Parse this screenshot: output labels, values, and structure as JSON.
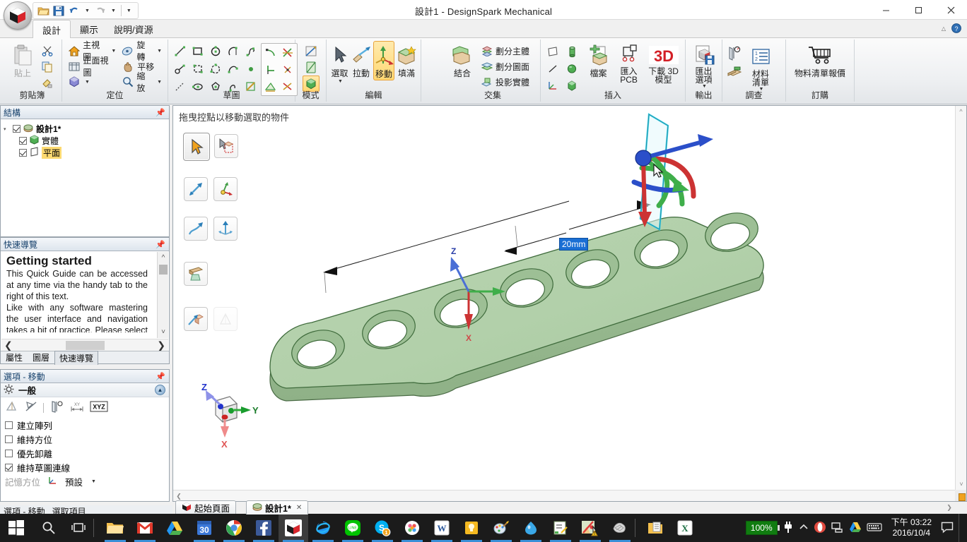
{
  "window": {
    "title": "設計1 - DesignSpark Mechanical",
    "minimize": "–",
    "maximize": "☐",
    "close": "✕"
  },
  "quick_access": {
    "open": "open-folder-icon",
    "save": "save-icon",
    "undo": "undo-icon",
    "redo": "redo-icon",
    "customize": "customize-icon"
  },
  "ribbon_tabs": [
    {
      "label": "設計",
      "active": true
    },
    {
      "label": "顯示",
      "active": false
    },
    {
      "label": "說明/資源",
      "active": false
    }
  ],
  "ribbon": {
    "groups": [
      {
        "name": "剪貼簿",
        "label": "剪貼簿",
        "big": [
          {
            "label": "貼上",
            "disabled": true
          }
        ],
        "small": [
          {
            "label": "",
            "icon": "scissors-icon"
          },
          {
            "label": "",
            "icon": "copy-icon"
          },
          {
            "label": "",
            "icon": "format-painter-icon"
          }
        ]
      },
      {
        "name": "定位",
        "label": "定位",
        "rows": [
          {
            "left": "主視圖",
            "left_caret": true,
            "right": "旋轉",
            "right_caret": true
          },
          {
            "left": "正面視圖",
            "left_caret": false,
            "right": "平移",
            "right_caret": false
          },
          {
            "left": "",
            "left_caret": true,
            "right": "縮放",
            "right_caret": true
          }
        ]
      },
      {
        "name": "草圖",
        "label": "草圖"
      },
      {
        "name": "模式",
        "label": "模式"
      },
      {
        "name": "編輯",
        "label": "編輯",
        "buttons": [
          {
            "label": "選取",
            "caret": true,
            "selected": false
          },
          {
            "label": "拉動",
            "caret": false,
            "selected": false
          },
          {
            "label": "移動",
            "caret": false,
            "selected": true
          },
          {
            "label": "填滿",
            "caret": false,
            "selected": false
          }
        ]
      },
      {
        "name": "交集",
        "label": "交集",
        "big": [
          {
            "label": "結合"
          }
        ],
        "small": [
          {
            "label": "劃分主體"
          },
          {
            "label": "劃分圖面"
          },
          {
            "label": "投影實體"
          }
        ]
      },
      {
        "name": "插入",
        "label": "插入",
        "buttons": [
          {
            "label": "檔案"
          },
          {
            "label": "匯入\nPCB"
          },
          {
            "label": "下載 3D\n模型"
          }
        ]
      },
      {
        "name": "輸出",
        "label": "輸出",
        "buttons": [
          {
            "label": "匯出\n選項",
            "caret": true
          }
        ]
      },
      {
        "name": "調查",
        "label": "調查",
        "buttons": [
          {
            "label": "材料\n清單",
            "caret": true
          }
        ]
      },
      {
        "name": "訂購",
        "label": "訂購",
        "buttons": [
          {
            "label": "物料清單報價"
          }
        ]
      }
    ]
  },
  "structure_panel": {
    "title": "結構",
    "nodes": [
      {
        "label": "設計1*",
        "checked": true,
        "level": 0,
        "icon": "design-icon",
        "bold": true
      },
      {
        "label": "實體",
        "checked": true,
        "level": 1,
        "icon": "solid-icon",
        "highlight": false
      },
      {
        "label": "平面",
        "checked": true,
        "level": 1,
        "icon": "plane-icon",
        "highlight": true
      }
    ]
  },
  "quick_guide": {
    "title": "快速導覽",
    "heading": "Getting started",
    "paragraphs": [
      "This Quick Guide can be accessed at any time via the handy tab to the right of this text.",
      "Like with any software mastering the user interface and navigation takes a bit of practice. Please select a topic of"
    ],
    "tabs": [
      {
        "label": "屬性",
        "active": false
      },
      {
        "label": "圖層",
        "active": false
      },
      {
        "label": "快速導覽",
        "active": true
      }
    ]
  },
  "options_panel": {
    "title": "選項 - 移動",
    "section": "一般",
    "tool_icons": [
      "align-icon",
      "anchor-icon",
      "ruler-icon",
      "dimension-icon",
      "xyz-icon"
    ],
    "checkboxes": [
      {
        "label": "建立陣列",
        "checked": false
      },
      {
        "label": "維持方位",
        "checked": false
      },
      {
        "label": "優先卸離",
        "checked": false
      },
      {
        "label": "維持草圖連線",
        "checked": true
      }
    ],
    "memory": {
      "label": "記憶方位",
      "value": "預設"
    }
  },
  "viewport": {
    "hint": "拖曳控點以移動選取的物件",
    "dimension_label": "20mm",
    "tools": [
      {
        "name": "select-arrow-tool",
        "selected": true,
        "disabled": false
      },
      {
        "name": "select-box-tool",
        "selected": false,
        "disabled": false
      },
      {
        "name": "move-arrow-tool",
        "selected": false,
        "disabled": false
      },
      {
        "name": "move-axes-tool",
        "selected": false,
        "disabled": false
      },
      {
        "name": "pull-curve-tool",
        "selected": false,
        "disabled": false
      },
      {
        "name": "pull-direction-tool",
        "selected": false,
        "disabled": false
      },
      {
        "name": "sweep-tool",
        "selected": false,
        "disabled": false
      },
      {
        "name": "detach-move-tool",
        "selected": false,
        "disabled": false
      },
      {
        "name": "ghost-tool",
        "selected": false,
        "disabled": true
      }
    ],
    "axis_triad": {
      "x": "X",
      "y": "Y",
      "z": "Z"
    },
    "model_axis": {
      "x": "X",
      "z": "Z"
    }
  },
  "document_tabs": [
    {
      "label": "起始頁面",
      "active": false,
      "closable": false
    },
    {
      "label": "設計1*",
      "active": true,
      "closable": true,
      "close": "✕"
    }
  ],
  "status_bar": {
    "items": [
      "選項 - 移動",
      "選取項目"
    ]
  },
  "taskbar": {
    "start": "windows-start-icon",
    "search": "search-icon",
    "taskview": "task-view-icon",
    "apps": [
      {
        "name": "file-explorer-icon",
        "running": true
      },
      {
        "name": "gmail-icon",
        "running": true
      },
      {
        "name": "google-drive-icon",
        "running": false
      },
      {
        "name": "calendar-icon",
        "running": true,
        "badge": "30"
      },
      {
        "name": "chrome-icon",
        "running": true
      },
      {
        "name": "facebook-icon",
        "running": true
      },
      {
        "name": "designspark-icon",
        "running": true,
        "active": true
      },
      {
        "name": "internet-explorer-icon",
        "running": true
      },
      {
        "name": "line-icon",
        "running": true
      },
      {
        "name": "skype-icon",
        "running": true,
        "badge": "1"
      },
      {
        "name": "dropbox-icon",
        "running": true
      },
      {
        "name": "word-icon",
        "running": true
      },
      {
        "name": "notes-icon",
        "running": true
      },
      {
        "name": "paint-icon",
        "running": true
      },
      {
        "name": "blender-icon",
        "running": true
      },
      {
        "name": "notepad-editor-icon",
        "running": true
      },
      {
        "name": "photo-editor-icon",
        "running": true,
        "warning": true
      },
      {
        "name": "mesh-icon",
        "running": true
      },
      {
        "name": "documents-icon",
        "running": false
      },
      {
        "name": "excel-icon",
        "running": false
      }
    ],
    "tray": {
      "battery": "100%",
      "power": "power-plug-icon",
      "chevron": "show-hidden-icons-icon",
      "opera": "opera-icon",
      "network": "network-icon",
      "drive": "google-drive-tray-icon",
      "keyboard": "keyboard-icon",
      "time": "下午 03:22",
      "date": "2016/10/4",
      "action_center": "action-center-icon"
    }
  }
}
